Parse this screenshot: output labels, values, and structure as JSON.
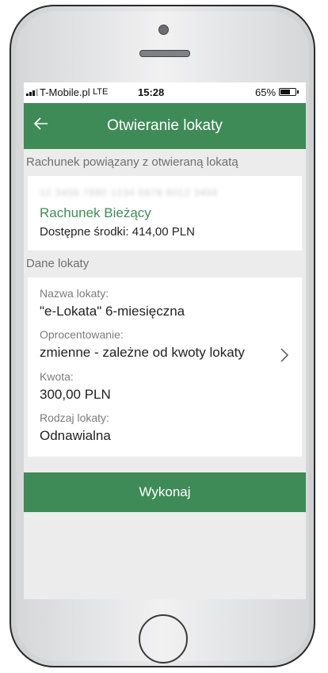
{
  "status_bar": {
    "carrier": "T-Mobile.pl",
    "network": "LTE",
    "time": "15:28",
    "battery": "65%",
    "battery_level": 0.65
  },
  "app_bar": {
    "back_icon": "arrow-left-icon",
    "title": "Otwieranie lokaty"
  },
  "account_section": {
    "label": "Rachunek powiązany z otwieraną lokatą",
    "account_number_blurred": "12 3456 7890 1234 5678 9012 3456",
    "account_name": "Rachunek Bieżący",
    "available_funds": "Dostępne środki: 414,00 PLN"
  },
  "deposit_section": {
    "label": "Dane lokaty",
    "fields": [
      {
        "label": "Nazwa lokaty:",
        "value": "\"e-Lokata\" 6-miesięczna"
      },
      {
        "label": "Oprocentowanie:",
        "value": "zmienne - zależne od kwoty lokaty"
      },
      {
        "label": "Kwota:",
        "value": "300,00 PLN"
      },
      {
        "label": "Rodzaj lokaty:",
        "value": "Odnawialna"
      }
    ],
    "chevron_icon": "chevron-right-icon"
  },
  "actions": {
    "execute_label": "Wykonaj"
  },
  "colors": {
    "brand_green": "#3f8b58",
    "background": "#ececec"
  }
}
